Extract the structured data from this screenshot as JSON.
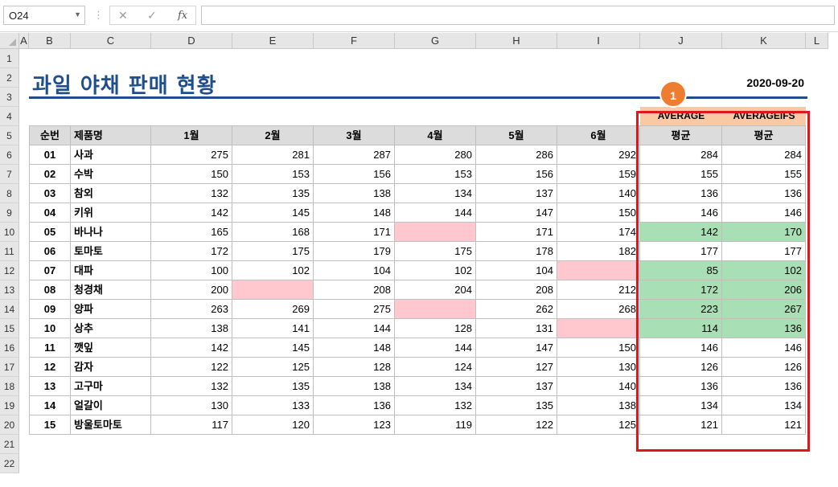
{
  "formula_bar": {
    "name_box": "O24",
    "cancel_glyph": "✕",
    "enter_glyph": "✓",
    "fx_label": "fx",
    "formula": ""
  },
  "columns": [
    "A",
    "B",
    "C",
    "D",
    "E",
    "F",
    "G",
    "H",
    "I",
    "J",
    "K",
    "L"
  ],
  "rows": [
    "1",
    "2",
    "3",
    "4",
    "5",
    "6",
    "7",
    "8",
    "9",
    "10",
    "11",
    "12",
    "13",
    "14",
    "15",
    "16",
    "17",
    "18",
    "19",
    "20",
    "21",
    "22"
  ],
  "sheet": {
    "title": "과일 야채 판매 현황",
    "date": "2020-09-20",
    "badge": "1",
    "fn_labels": [
      "AVERAGE",
      "AVERAGEIFS"
    ],
    "headers": [
      "순번",
      "제품명",
      "1월",
      "2월",
      "3월",
      "4월",
      "5월",
      "6월",
      "평균",
      "평균"
    ],
    "data": [
      [
        "01",
        "사과",
        "275",
        "281",
        "287",
        "280",
        "286",
        "292",
        "284",
        "284"
      ],
      [
        "02",
        "수박",
        "150",
        "153",
        "156",
        "153",
        "156",
        "159",
        "155",
        "155"
      ],
      [
        "03",
        "참외",
        "132",
        "135",
        "138",
        "134",
        "137",
        "140",
        "136",
        "136"
      ],
      [
        "04",
        "키위",
        "142",
        "145",
        "148",
        "144",
        "147",
        "150",
        "146",
        "146"
      ],
      [
        "05",
        "바나나",
        "165",
        "168",
        "171",
        "",
        "171",
        "174",
        "142",
        "170"
      ],
      [
        "06",
        "토마토",
        "172",
        "175",
        "179",
        "175",
        "178",
        "182",
        "177",
        "177"
      ],
      [
        "07",
        "대파",
        "100",
        "102",
        "104",
        "102",
        "104",
        "",
        "85",
        "102"
      ],
      [
        "08",
        "청경채",
        "200",
        "",
        "208",
        "204",
        "208",
        "212",
        "172",
        "206"
      ],
      [
        "09",
        "양파",
        "263",
        "269",
        "275",
        "",
        "262",
        "268",
        "223",
        "267"
      ],
      [
        "10",
        "상추",
        "138",
        "141",
        "144",
        "128",
        "131",
        "",
        "114",
        "136"
      ],
      [
        "11",
        "깻잎",
        "142",
        "145",
        "148",
        "144",
        "147",
        "150",
        "146",
        "146"
      ],
      [
        "12",
        "감자",
        "122",
        "125",
        "128",
        "124",
        "127",
        "130",
        "126",
        "126"
      ],
      [
        "13",
        "고구마",
        "132",
        "135",
        "138",
        "134",
        "137",
        "140",
        "136",
        "136"
      ],
      [
        "14",
        "얼갈이",
        "130",
        "133",
        "136",
        "132",
        "135",
        "138",
        "134",
        "134"
      ],
      [
        "15",
        "방울토마토",
        "117",
        "120",
        "123",
        "119",
        "122",
        "125",
        "121",
        "121"
      ]
    ]
  },
  "colors": {
    "title": "#1f4e8c",
    "header_fill": "#dcdcdc",
    "label_fill": "#f8c9a4",
    "empty_cell_fill": "#ffc7ce",
    "highlight_fill": "#a9dfb5",
    "callout_border": "#e0161b",
    "badge_fill": "#ee7d31"
  }
}
